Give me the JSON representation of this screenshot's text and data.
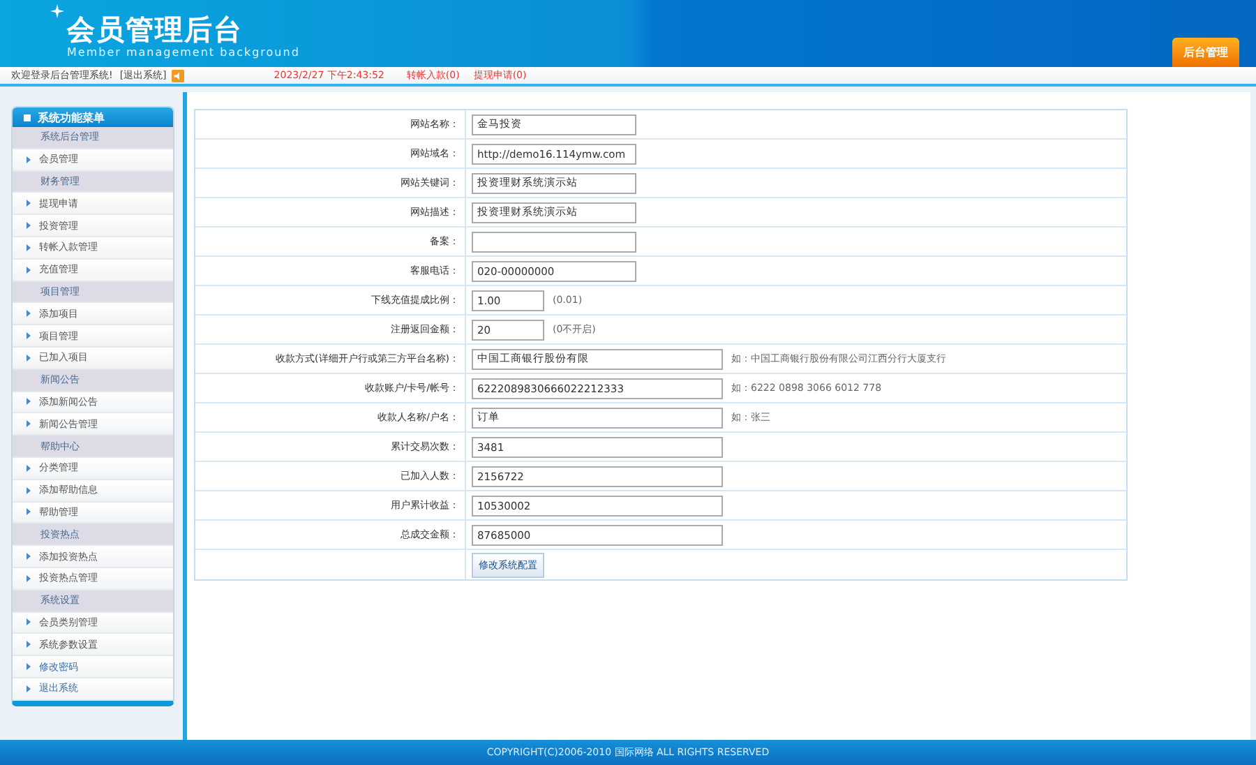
{
  "header": {
    "title": "会员管理后台",
    "subtitle": "Member management background",
    "admin_button": "后台管理"
  },
  "topbar": {
    "welcome": "欢迎登录后台管理系统!",
    "logout": "[退出系统]",
    "datetime": "2023/2/27 下午2:43:52",
    "transfers": "转帐入款(0)",
    "withdrawals": "提现申请(0)"
  },
  "sidebar": {
    "title": "系统功能菜单",
    "items": [
      {
        "kind": "section",
        "label": "系统后台管理"
      },
      {
        "kind": "item",
        "label": "会员管理"
      },
      {
        "kind": "section",
        "label": "财务管理"
      },
      {
        "kind": "item",
        "label": "提现申请"
      },
      {
        "kind": "item",
        "label": "投资管理"
      },
      {
        "kind": "item",
        "label": "转帐入款管理"
      },
      {
        "kind": "item",
        "label": "充值管理"
      },
      {
        "kind": "section",
        "label": "项目管理"
      },
      {
        "kind": "item",
        "label": "添加项目"
      },
      {
        "kind": "item",
        "label": "项目管理"
      },
      {
        "kind": "item",
        "label": "已加入项目"
      },
      {
        "kind": "section",
        "label": "新闻公告"
      },
      {
        "kind": "item",
        "label": "添加新闻公告"
      },
      {
        "kind": "item",
        "label": "新闻公告管理"
      },
      {
        "kind": "section",
        "label": "帮助中心"
      },
      {
        "kind": "item",
        "label": "分类管理"
      },
      {
        "kind": "item",
        "label": "添加帮助信息"
      },
      {
        "kind": "item",
        "label": "帮助管理"
      },
      {
        "kind": "section",
        "label": "投资热点"
      },
      {
        "kind": "item",
        "label": "添加投资热点"
      },
      {
        "kind": "item",
        "label": "投资热点管理"
      },
      {
        "kind": "section",
        "label": "系统设置"
      },
      {
        "kind": "item",
        "label": "会员类别管理"
      },
      {
        "kind": "item",
        "label": "系统参数设置"
      },
      {
        "kind": "action",
        "label": "修改密码"
      },
      {
        "kind": "action",
        "label": "退出系统"
      }
    ]
  },
  "form": {
    "rows": [
      {
        "kind": "medium",
        "label": "网站名称：",
        "value": "金马投资"
      },
      {
        "kind": "medium",
        "label": "网站域名：",
        "value": "http://demo16.114ymw.com"
      },
      {
        "kind": "medium",
        "label": "网站关键词：",
        "value": "投资理财系统演示站"
      },
      {
        "kind": "medium",
        "label": "网站描述：",
        "value": "投资理财系统演示站"
      },
      {
        "kind": "medium",
        "label": "备案：",
        "value": ""
      },
      {
        "kind": "medium",
        "label": "客服电话：",
        "value": "020-00000000"
      },
      {
        "kind": "short",
        "label": "下线充值提成比例：",
        "value": "1.00",
        "note": "(0.01)"
      },
      {
        "kind": "short",
        "label": "注册返回金额：",
        "value": "20",
        "note": "(0不开启)"
      },
      {
        "kind": "long",
        "label": "收款方式(详细开户行或第三方平台名称)：",
        "value": "中国工商银行股份有限",
        "note": "如：中国工商银行股份有限公司江西分行大厦支行"
      },
      {
        "kind": "long",
        "label": "收款账户/卡号/帐号：",
        "value": "6222089830666022212333",
        "note": "如：6222 0898 3066 6012 778"
      },
      {
        "kind": "long",
        "label": "收款人名称/户名：",
        "value": "订单",
        "note": "如：张三"
      },
      {
        "kind": "long",
        "label": "累计交易次数：",
        "value": "3481"
      },
      {
        "kind": "long",
        "label": "已加入人数：",
        "value": "2156722"
      },
      {
        "kind": "long",
        "label": "用户累计收益：",
        "value": "10530002"
      },
      {
        "kind": "long",
        "label": "总成交金额：",
        "value": "87685000"
      }
    ],
    "submit": "修改系统配置"
  },
  "footer": "COPYRIGHT(C)2006-2010 国际网络 ALL RIGHTS RESERVED"
}
